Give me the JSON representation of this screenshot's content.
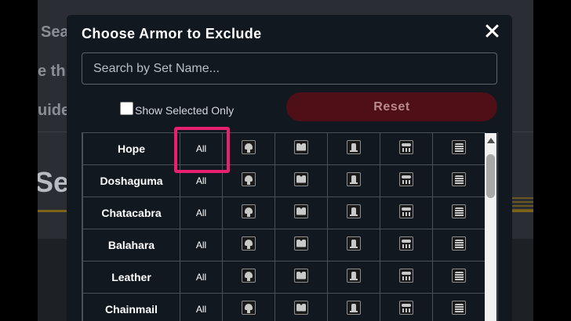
{
  "background": {
    "texts": [
      "Sea",
      "e th",
      "uide",
      "Set"
    ]
  },
  "modal": {
    "title": "Choose Armor to Exclude",
    "close_icon": "close-icon",
    "search_placeholder": "Search by Set Name...",
    "show_selected_label": "Show Selected Only",
    "show_selected_checked": false,
    "reset_label": "Reset",
    "all_label": "All",
    "armor_icons": [
      "helm-icon",
      "chest-icon",
      "arms-icon",
      "waist-icon",
      "legs-icon"
    ],
    "sets": [
      "Hope",
      "Doshaguma",
      "Chatacabra",
      "Balahara",
      "Leather",
      "Chainmail"
    ],
    "highlight_color": "#e8206f",
    "reset_color": "#4e1016"
  }
}
